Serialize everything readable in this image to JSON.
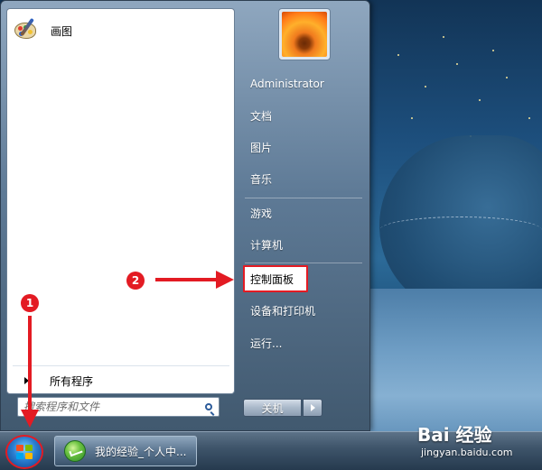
{
  "start_menu": {
    "pinned_programs": [
      {
        "label": "画图",
        "icon": "paint-palette-icon"
      }
    ],
    "all_programs_label": "所有程序",
    "search": {
      "placeholder": "搜索程序和文件",
      "icon": "search-icon"
    },
    "right_pane": {
      "user_picture": "user-flower-avatar",
      "items": [
        {
          "label": "Administrator"
        },
        {
          "label": "文档"
        },
        {
          "label": "图片"
        },
        {
          "label": "音乐"
        },
        {
          "label": "游戏"
        },
        {
          "label": "计算机"
        },
        {
          "label": "控制面板",
          "highlighted": true
        },
        {
          "label": "设备和打印机"
        },
        {
          "label": "运行..."
        }
      ],
      "shutdown_label": "关机"
    }
  },
  "taskbar": {
    "start_button_icon": "windows-logo-icon",
    "open_window": {
      "label": "我的经验_个人中...",
      "icon": "ie-browser-icon"
    }
  },
  "annotations": [
    {
      "number": "1",
      "target": "start-button"
    },
    {
      "number": "2",
      "target": "control-panel"
    }
  ],
  "watermark": {
    "main": "Bai 经验",
    "sub": "jingyan.baidu.com"
  },
  "colors": {
    "highlight_red": "#e31b23",
    "menu_left_bg": "#ffffff",
    "menu_right_text": "#ffffff"
  }
}
